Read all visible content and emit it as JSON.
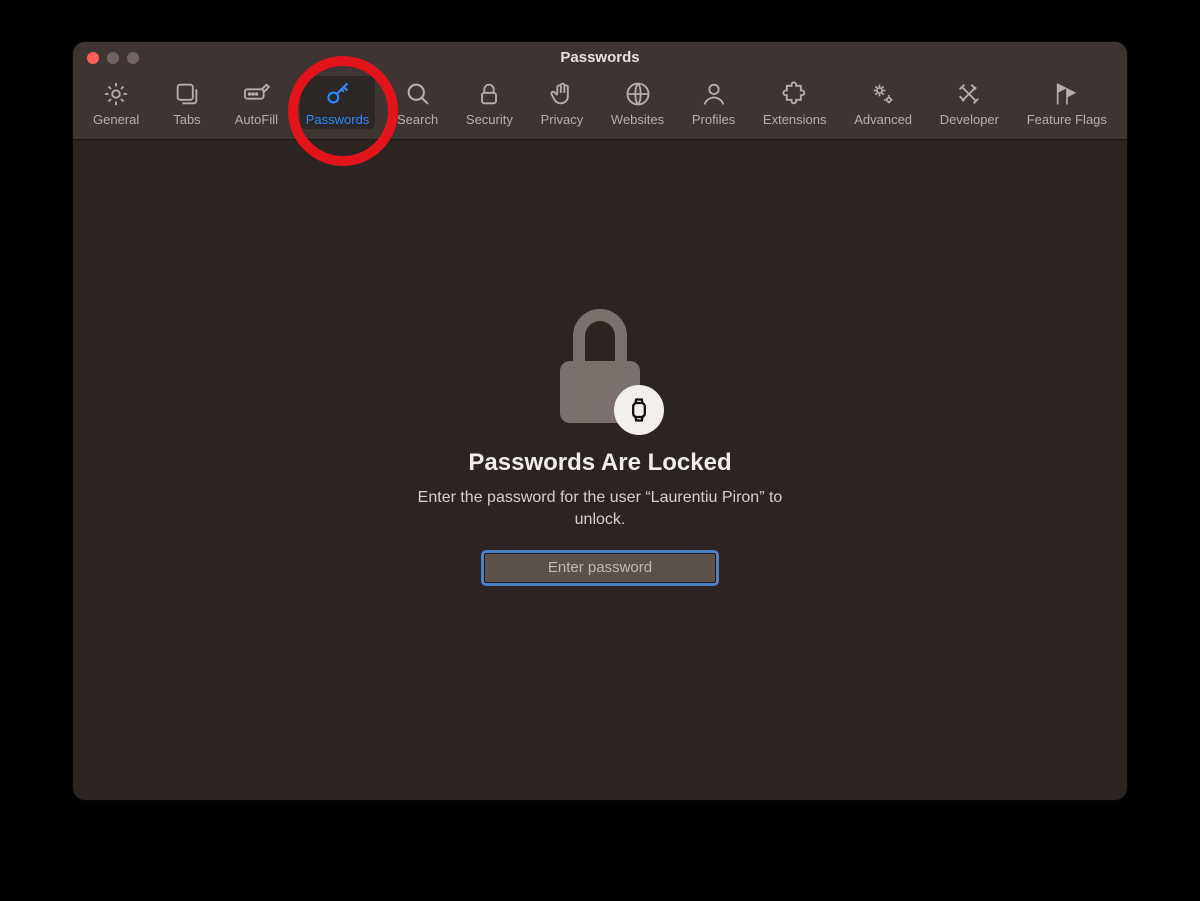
{
  "window": {
    "title": "Passwords"
  },
  "toolbar": {
    "items": [
      {
        "id": "general",
        "label": "General",
        "icon": "gear-icon"
      },
      {
        "id": "tabs",
        "label": "Tabs",
        "icon": "tabs-icon"
      },
      {
        "id": "autofill",
        "label": "AutoFill",
        "icon": "pencil-line-icon"
      },
      {
        "id": "passwords",
        "label": "Passwords",
        "icon": "key-icon",
        "selected": true
      },
      {
        "id": "search",
        "label": "Search",
        "icon": "search-icon"
      },
      {
        "id": "security",
        "label": "Security",
        "icon": "lock-icon"
      },
      {
        "id": "privacy",
        "label": "Privacy",
        "icon": "hand-icon"
      },
      {
        "id": "websites",
        "label": "Websites",
        "icon": "globe-icon"
      },
      {
        "id": "profiles",
        "label": "Profiles",
        "icon": "person-icon"
      },
      {
        "id": "extensions",
        "label": "Extensions",
        "icon": "puzzle-icon"
      },
      {
        "id": "advanced",
        "label": "Advanced",
        "icon": "gears-icon"
      },
      {
        "id": "developer",
        "label": "Developer",
        "icon": "tools-icon"
      },
      {
        "id": "featureflags",
        "label": "Feature Flags",
        "icon": "flags-icon"
      }
    ]
  },
  "locked": {
    "heading": "Passwords Are Locked",
    "subtext": "Enter the password for the user “Laurentiu Piron” to unlock.",
    "placeholder": "Enter password"
  },
  "annotation": {
    "highlight": "passwords"
  },
  "colors": {
    "accent": "#2b8aff",
    "window_bg": "#2c2421",
    "toolbar_bg": "#3e3532",
    "annotation_ring": "#e3131b"
  }
}
